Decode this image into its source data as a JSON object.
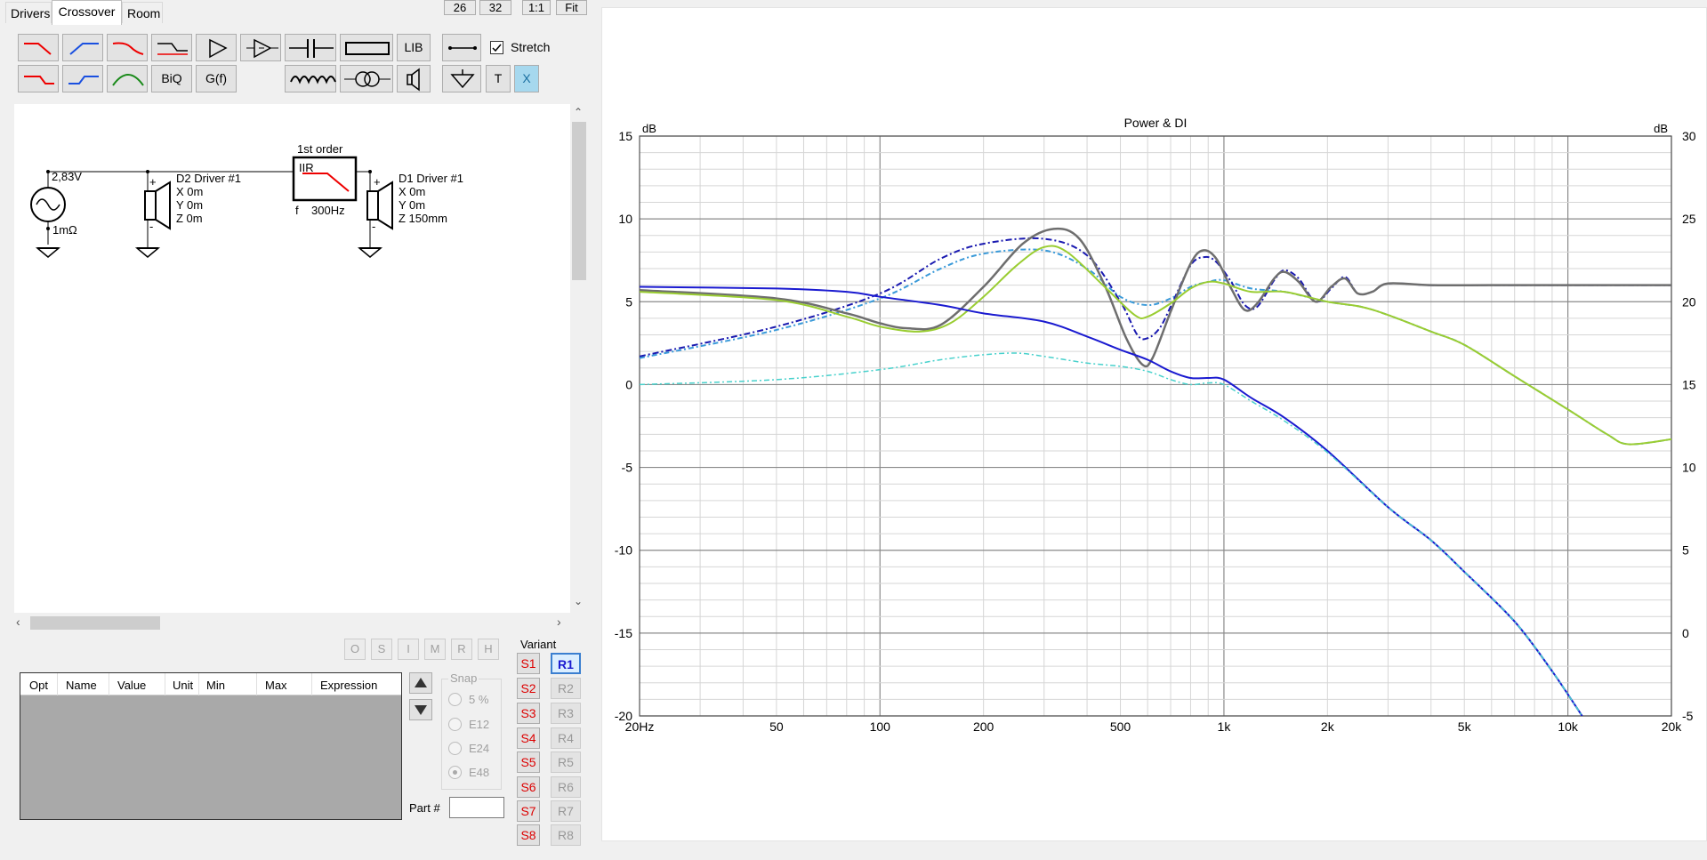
{
  "tabs": {
    "drivers": "Drivers",
    "crossover": "Crossover",
    "room": "Room"
  },
  "top_buttons": [
    "26",
    "32",
    "1:1",
    "Fit"
  ],
  "palette": {
    "lib": "LIB",
    "stretch": "Stretch",
    "biq": "BiQ",
    "gf": "G(f)",
    "t": "T",
    "x": "X"
  },
  "schematic": {
    "title": "1st order",
    "block_type": "IIR",
    "f_label": "f",
    "freq": "300Hz",
    "source_voltage": "2,83V",
    "source_impedance": "1mΩ",
    "driver2": {
      "name": "D2 Driver #1",
      "x": "X 0m",
      "y": "Y 0m",
      "z": "Z 0m"
    },
    "driver1": {
      "name": "D1 Driver #1",
      "x": "X 0m",
      "y": "Y 0m",
      "z": "Z 150mm"
    },
    "plus": "+",
    "minus": "-"
  },
  "mode_buttons": [
    "O",
    "S",
    "I",
    "M",
    "R",
    "H"
  ],
  "table_headers": [
    "Opt",
    "Name",
    "Value",
    "Unit",
    "Min",
    "Max",
    "Expression"
  ],
  "snap": {
    "title": "Snap",
    "options": [
      "5 %",
      "E12",
      "E24",
      "E48"
    ],
    "selected": "E48"
  },
  "part": {
    "label": "Part #",
    "value": ""
  },
  "variant": {
    "title": "Variant",
    "s": [
      "S1",
      "S2",
      "S3",
      "S4",
      "S5",
      "S6",
      "S7",
      "S8"
    ],
    "r": [
      "R1",
      "R2",
      "R3",
      "R4",
      "R5",
      "R6",
      "R7",
      "R8"
    ],
    "active": "R1"
  },
  "chart_data": {
    "type": "line",
    "title": "Power & DI",
    "left_unit": "dB",
    "right_unit": "dB",
    "y_left": [
      15,
      10,
      5,
      0,
      -5,
      -10,
      -15,
      -20
    ],
    "y_left_range": [
      -20,
      15
    ],
    "y_right": [
      30,
      25,
      20,
      15,
      10,
      5,
      0,
      -5
    ],
    "y_right_range": [
      -5,
      30
    ],
    "x_scale": "log",
    "x_range": [
      20,
      20000
    ],
    "x_ticks": [
      {
        "v": 20,
        "label": "20Hz"
      },
      {
        "v": 50,
        "label": "50"
      },
      {
        "v": 100,
        "label": "100"
      },
      {
        "v": 200,
        "label": "200"
      },
      {
        "v": 500,
        "label": "500"
      },
      {
        "v": 1000,
        "label": "1k"
      },
      {
        "v": 2000,
        "label": "2k"
      },
      {
        "v": 5000,
        "label": "5k"
      },
      {
        "v": 10000,
        "label": "10k"
      },
      {
        "v": 20000,
        "label": "20k"
      }
    ],
    "grid": true,
    "series": [
      {
        "color": "#3a9ad9",
        "dash": "6,3,2,3",
        "width": 2,
        "points": [
          [
            20,
            1.6
          ],
          [
            50,
            3.3
          ],
          [
            100,
            5.2
          ],
          [
            150,
            7
          ],
          [
            200,
            7.9
          ],
          [
            300,
            8.1
          ],
          [
            400,
            7
          ],
          [
            500,
            5.3
          ],
          [
            600,
            4.8
          ],
          [
            700,
            5.2
          ],
          [
            800,
            5.9
          ],
          [
            900,
            6.2
          ],
          [
            1000,
            6.3
          ],
          [
            1200,
            5.8
          ],
          [
            1500,
            5.6
          ],
          [
            2000,
            5.0
          ],
          [
            2500,
            4.7
          ],
          [
            3000,
            4.2
          ],
          [
            4000,
            3.2
          ],
          [
            5000,
            2.4
          ],
          [
            7000,
            0.5
          ],
          [
            10000,
            -1.5
          ],
          [
            13000,
            -3.0
          ],
          [
            15000,
            -3.6
          ],
          [
            20000,
            -3.3
          ]
        ]
      },
      {
        "color": "#1a1ab0",
        "dash": "7,3,2,3",
        "width": 2,
        "points": [
          [
            20,
            1.7
          ],
          [
            50,
            3.5
          ],
          [
            100,
            5.5
          ],
          [
            150,
            7.6
          ],
          [
            200,
            8.5
          ],
          [
            300,
            8.8
          ],
          [
            400,
            7.8
          ],
          [
            500,
            5.0
          ],
          [
            560,
            3.0
          ],
          [
            600,
            2.8
          ],
          [
            650,
            3.4
          ],
          [
            700,
            4.7
          ],
          [
            800,
            7.2
          ],
          [
            880,
            7.7
          ],
          [
            950,
            7.4
          ],
          [
            1050,
            6.2
          ],
          [
            1150,
            4.8
          ],
          [
            1250,
            4.7
          ],
          [
            1400,
            6.3
          ],
          [
            1500,
            6.9
          ],
          [
            1650,
            6.4
          ],
          [
            1850,
            5.0
          ],
          [
            2050,
            5.8
          ],
          [
            2250,
            6.5
          ],
          [
            2450,
            5.5
          ],
          [
            2700,
            5.6
          ],
          [
            3000,
            6.1
          ],
          [
            4000,
            6.0
          ],
          [
            6000,
            6.0
          ],
          [
            10000,
            6.0
          ],
          [
            20000,
            6.0
          ]
        ]
      },
      {
        "color": "#6e6e6e",
        "dash": "",
        "width": 2.5,
        "points": [
          [
            20,
            5.7
          ],
          [
            50,
            5.2
          ],
          [
            80,
            4.3
          ],
          [
            100,
            3.7
          ],
          [
            120,
            3.4
          ],
          [
            150,
            3.6
          ],
          [
            200,
            5.9
          ],
          [
            260,
            8.5
          ],
          [
            320,
            9.4
          ],
          [
            380,
            8.8
          ],
          [
            450,
            6.0
          ],
          [
            520,
            2.8
          ],
          [
            580,
            1.2
          ],
          [
            620,
            1.6
          ],
          [
            700,
            4.4
          ],
          [
            800,
            7.3
          ],
          [
            870,
            8.1
          ],
          [
            950,
            7.6
          ],
          [
            1050,
            5.8
          ],
          [
            1150,
            4.5
          ],
          [
            1250,
            4.9
          ],
          [
            1400,
            6.4
          ],
          [
            1500,
            6.8
          ],
          [
            1650,
            6.2
          ],
          [
            1850,
            5.0
          ],
          [
            2050,
            5.9
          ],
          [
            2250,
            6.4
          ],
          [
            2450,
            5.5
          ],
          [
            2700,
            5.6
          ],
          [
            3000,
            6.1
          ],
          [
            4000,
            6.0
          ],
          [
            6000,
            6.0
          ],
          [
            10000,
            6.0
          ],
          [
            20000,
            6.0
          ]
        ]
      },
      {
        "color": "#9acd32",
        "dash": "",
        "width": 2,
        "points": [
          [
            20,
            5.6
          ],
          [
            50,
            5.1
          ],
          [
            80,
            4.1
          ],
          [
            100,
            3.5
          ],
          [
            130,
            3.2
          ],
          [
            160,
            3.7
          ],
          [
            200,
            5.3
          ],
          [
            250,
            7.2
          ],
          [
            300,
            8.3
          ],
          [
            350,
            8.0
          ],
          [
            450,
            5.9
          ],
          [
            550,
            4.2
          ],
          [
            600,
            4.1
          ],
          [
            700,
            4.9
          ],
          [
            800,
            5.8
          ],
          [
            900,
            6.2
          ],
          [
            1000,
            6.1
          ],
          [
            1200,
            5.6
          ],
          [
            1500,
            5.6
          ],
          [
            2000,
            5.0
          ],
          [
            2500,
            4.7
          ],
          [
            3000,
            4.2
          ],
          [
            4000,
            3.2
          ],
          [
            5000,
            2.4
          ],
          [
            7000,
            0.5
          ],
          [
            10000,
            -1.5
          ],
          [
            13000,
            -3.0
          ],
          [
            15000,
            -3.6
          ],
          [
            20000,
            -3.3
          ]
        ]
      },
      {
        "color": "#1a1ad0",
        "dash": "",
        "width": 2,
        "points": [
          [
            20,
            5.9
          ],
          [
            50,
            5.8
          ],
          [
            80,
            5.6
          ],
          [
            100,
            5.3
          ],
          [
            150,
            4.8
          ],
          [
            200,
            4.3
          ],
          [
            300,
            3.8
          ],
          [
            400,
            2.9
          ],
          [
            500,
            2.1
          ],
          [
            600,
            1.5
          ],
          [
            700,
            0.8
          ],
          [
            800,
            0.4
          ],
          [
            900,
            0.4
          ],
          [
            1000,
            0.3
          ],
          [
            1200,
            -0.8
          ],
          [
            1500,
            -2.0
          ],
          [
            2000,
            -4.0
          ],
          [
            3000,
            -7.4
          ],
          [
            4000,
            -9.4
          ],
          [
            5000,
            -11.3
          ],
          [
            7000,
            -14.3
          ],
          [
            9000,
            -17.3
          ],
          [
            11000,
            -20.0
          ]
        ]
      },
      {
        "color": "#48d1cc",
        "dash": "6,3,2,3",
        "width": 1.5,
        "points": [
          [
            20,
            0.0
          ],
          [
            50,
            0.3
          ],
          [
            100,
            0.9
          ],
          [
            150,
            1.5
          ],
          [
            200,
            1.8
          ],
          [
            250,
            1.9
          ],
          [
            300,
            1.7
          ],
          [
            400,
            1.3
          ],
          [
            500,
            1.1
          ],
          [
            600,
            0.8
          ],
          [
            700,
            0.3
          ],
          [
            800,
            0.0
          ],
          [
            900,
            0.1
          ],
          [
            1000,
            0.0
          ],
          [
            1200,
            -1.0
          ],
          [
            1500,
            -2.2
          ],
          [
            2000,
            -4.1
          ],
          [
            3000,
            -7.4
          ],
          [
            4000,
            -9.4
          ],
          [
            5000,
            -11.3
          ],
          [
            7000,
            -14.3
          ],
          [
            9000,
            -17.3
          ],
          [
            11000,
            -20.0
          ]
        ]
      }
    ]
  }
}
